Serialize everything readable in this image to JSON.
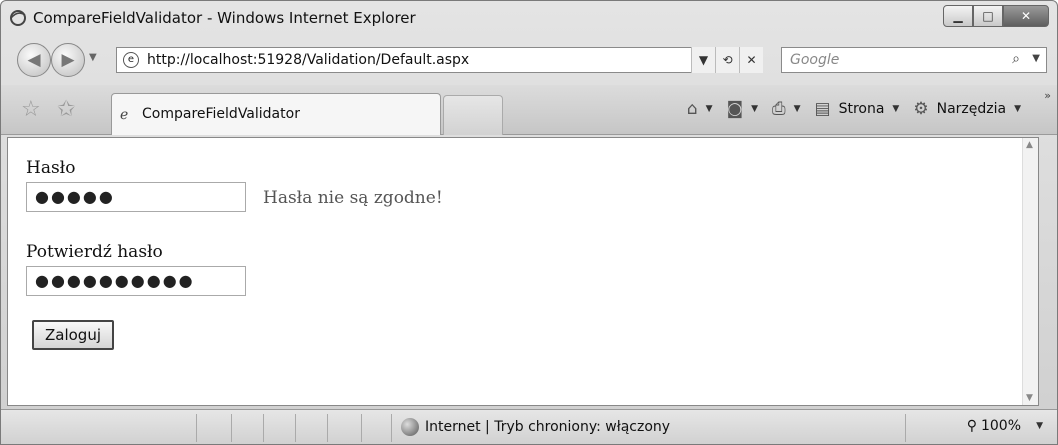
{
  "window": {
    "title": "CompareFieldValidator - Windows Internet Explorer"
  },
  "address": {
    "url": "http://localhost:51928/Validation/Default.aspx"
  },
  "search": {
    "placeholder": "Google"
  },
  "tab": {
    "label": "CompareFieldValidator"
  },
  "commands": {
    "page_label": "Strona",
    "tools_label": "Narzędzia"
  },
  "form": {
    "password_label": "Hasło",
    "password_value": "●●●●●",
    "error_message": "Hasła nie są zgodne!",
    "confirm_label": "Potwierdź hasło",
    "confirm_value": "●●●●●●●●●●",
    "submit_label": "Zaloguj"
  },
  "status": {
    "zone_text": "Internet | Tryb chroniony: włączony",
    "zoom": "100%"
  },
  "icons": {
    "back": "back-arrow-icon",
    "forward": "forward-arrow-icon",
    "favorites": "star-icon",
    "home": "home-icon",
    "feeds": "rss-icon",
    "print": "printer-icon"
  }
}
